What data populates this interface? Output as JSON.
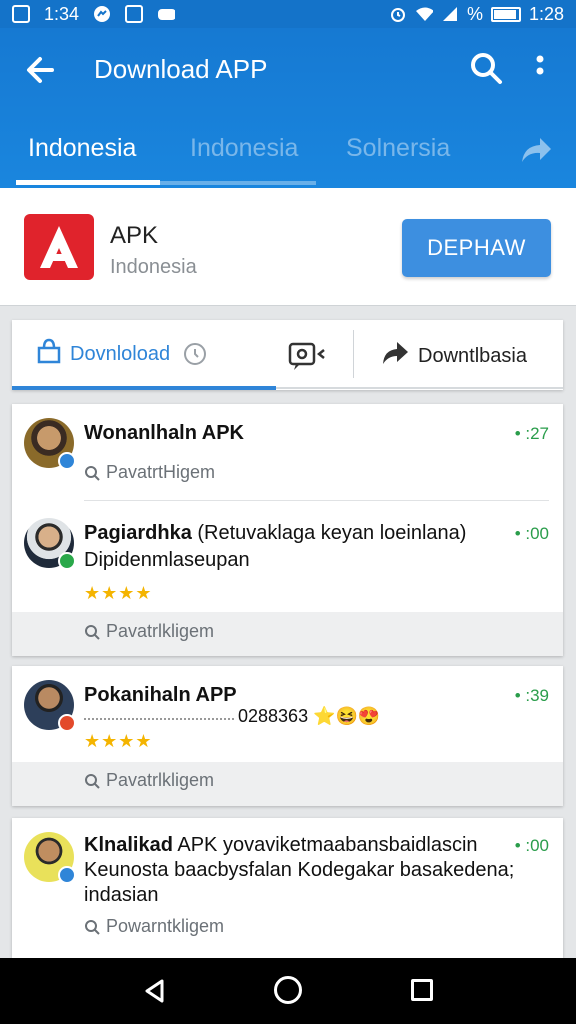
{
  "statusbar": {
    "time_left": "1:34",
    "time_right": "1:28",
    "signal_text": "%"
  },
  "appbar": {
    "title": "Download APP",
    "back_icon": "arrow-left-icon",
    "search_icon": "search-icon",
    "more_icon": "more-vert-icon"
  },
  "tabs": [
    {
      "label": "Indonesia",
      "active": true
    },
    {
      "label": "Indonesia",
      "active": false
    },
    {
      "label": "Solnersia",
      "active": false
    }
  ],
  "app": {
    "name": "APK",
    "subtitle": "Indonesia",
    "button_label": "DEPHAW",
    "logo_letter": "A",
    "brand_color": "#e0232c"
  },
  "subtabs": {
    "download_label": "Dovnloload",
    "share_label": "Downtlbasia"
  },
  "items": [
    {
      "title": "Wonanlhaln APK",
      "count": "• :27",
      "meta": "PavatrtHigem"
    },
    {
      "title_bold": "Pagiardhka",
      "title_rest": " (Retuvaklaga keyan loeinlana)",
      "line2": "Dipidenmlaseupan",
      "stars": "★★★★",
      "count": "• :00",
      "meta": "Pavatrlkligem"
    },
    {
      "title": "Pokanihaln APP",
      "line2": "0288363",
      "emoji": "⭐😆😍",
      "stars": "★★★★",
      "count": "• :39",
      "meta": "Pavatrlkligem"
    },
    {
      "title_bold": "Klnalikad",
      "title_rest": " APK yovaviketmaabansbaidlascin",
      "line2": "Keunosta baacbysfalan Kodegakar basakedena;",
      "line3": "indasian",
      "count": "• :00",
      "meta": "Powarntkligem"
    }
  ]
}
